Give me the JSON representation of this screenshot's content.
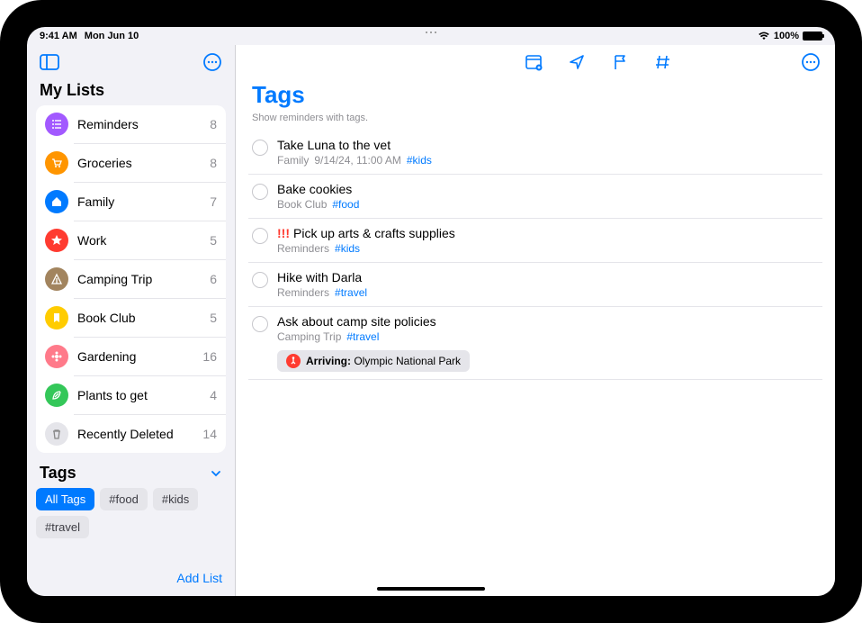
{
  "status": {
    "time": "9:41 AM",
    "date": "Mon Jun 10",
    "battery": "100%"
  },
  "sidebar": {
    "section_title": "My Lists",
    "lists": [
      {
        "name": "Reminders",
        "count": "8",
        "color": "#a259ff",
        "icon": "list"
      },
      {
        "name": "Groceries",
        "count": "8",
        "color": "#ff9500",
        "icon": "cart"
      },
      {
        "name": "Family",
        "count": "7",
        "color": "#007aff",
        "icon": "house"
      },
      {
        "name": "Work",
        "count": "5",
        "color": "#ff3b30",
        "icon": "star"
      },
      {
        "name": "Camping Trip",
        "count": "6",
        "color": "#a2845e",
        "icon": "tent"
      },
      {
        "name": "Book Club",
        "count": "5",
        "color": "#ffcc00",
        "icon": "bookmark"
      },
      {
        "name": "Gardening",
        "count": "16",
        "color": "#ff7a8a",
        "icon": "flower"
      },
      {
        "name": "Plants to get",
        "count": "4",
        "color": "#34c759",
        "icon": "leaf"
      },
      {
        "name": "Recently Deleted",
        "count": "14",
        "color": "#d1d1d6",
        "icon": "trash"
      }
    ],
    "tags_title": "Tags",
    "tags": [
      {
        "label": "All Tags",
        "active": true
      },
      {
        "label": "#food",
        "active": false
      },
      {
        "label": "#kids",
        "active": false
      },
      {
        "label": "#travel",
        "active": false
      }
    ],
    "add_list": "Add List"
  },
  "main": {
    "title": "Tags",
    "subtitle": "Show reminders with tags.",
    "reminders": [
      {
        "title": "Take Luna to the vet",
        "priority": "",
        "list": "Family",
        "due": "9/14/24, 11:00 AM",
        "tags": [
          "#kids"
        ]
      },
      {
        "title": "Bake cookies",
        "priority": "",
        "list": "Book Club",
        "due": "",
        "tags": [
          "#food"
        ]
      },
      {
        "title": "Pick up arts & crafts supplies",
        "priority": "!!!",
        "list": "Reminders",
        "due": "",
        "tags": [
          "#kids"
        ]
      },
      {
        "title": "Hike with Darla",
        "priority": "",
        "list": "Reminders",
        "due": "",
        "tags": [
          "#travel"
        ]
      },
      {
        "title": "Ask about camp site policies",
        "priority": "",
        "list": "Camping Trip",
        "due": "",
        "tags": [
          "#travel"
        ],
        "location_label": "Arriving:",
        "location_name": "Olympic National Park"
      }
    ]
  }
}
